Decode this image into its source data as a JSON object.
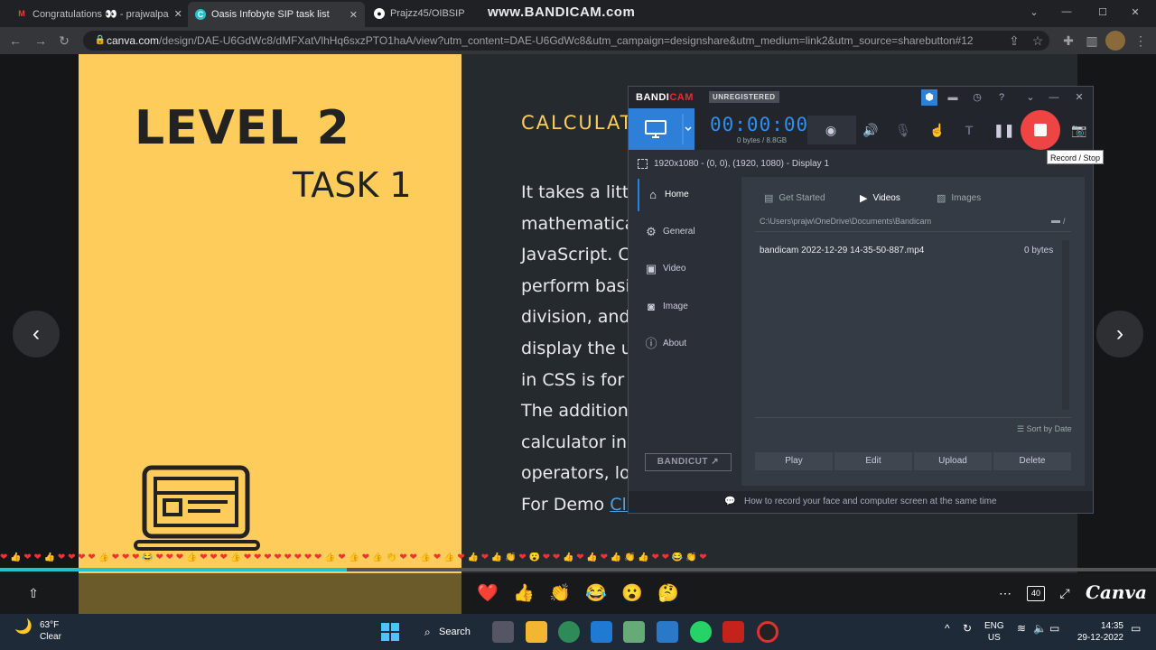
{
  "browser": {
    "tabs": [
      {
        "label": "Congratulations 👀 - prajwalpa",
        "icon": "gmail-icon"
      },
      {
        "label": "Oasis Infobyte SIP task list",
        "icon": "canva-icon"
      },
      {
        "label": "Prajzz45/OIBSIP",
        "icon": "github-icon"
      }
    ],
    "watermark": "www.BANDICAM.com",
    "url_host": "canva.com",
    "url_rest": "/design/DAE-U6GdWc8/dMFXatVlhHq6sxzPTO1haA/view?utm_content=DAE-U6GdWc8&utm_campaign=designshare&utm_medium=link2&utm_source=sharebutton#12"
  },
  "slide": {
    "level": "LEVEL 2",
    "task": "TASK 1",
    "heading": "CALCULAT",
    "lines": [
      "It takes a litt",
      "mathematica",
      "JavaScript. C",
      "perform basi",
      "division, and",
      "display the us",
      "in CSS is for",
      "The additiona",
      "calculator inc",
      "operators, lo"
    ],
    "demo_prefix": "For Demo ",
    "demo_link": "Cli",
    "progress": 0.3
  },
  "presenter": {
    "reactions": [
      "❤️",
      "👍",
      "👏",
      "😂",
      "😮",
      "🤔"
    ],
    "page_count": "40",
    "brand": "Canva"
  },
  "bandicam": {
    "logo_a": "BANDI",
    "logo_b": "CAM",
    "unregistered": "UNREGISTERED",
    "timer": "00:00:00",
    "bytes": "0 bytes / 8.8GB",
    "tooltip": "Record / Stop",
    "display": "1920x1080 - (0, 0), (1920, 1080) - Display 1",
    "nav": [
      "Home",
      "General",
      "Video",
      "Image",
      "About"
    ],
    "tabs": [
      "Get Started",
      "Videos",
      "Images"
    ],
    "path": "C:\\Users\\prajw\\OneDrive\\Documents\\Bandicam",
    "path_suffix": "/",
    "file_name": "bandicam 2022-12-29 14-35-50-887.mp4",
    "file_size": "0 bytes",
    "sort": "Sort by Date",
    "buttons": [
      "Play",
      "Edit",
      "Upload",
      "Delete"
    ],
    "bandicut": "BANDICUT",
    "footer": "How to record your face and computer screen at the same time"
  },
  "taskbar": {
    "temp": "63°F",
    "cond": "Clear",
    "search": "Search",
    "lang1": "ENG",
    "lang2": "US",
    "time": "14:35",
    "date": "29-12-2022"
  }
}
